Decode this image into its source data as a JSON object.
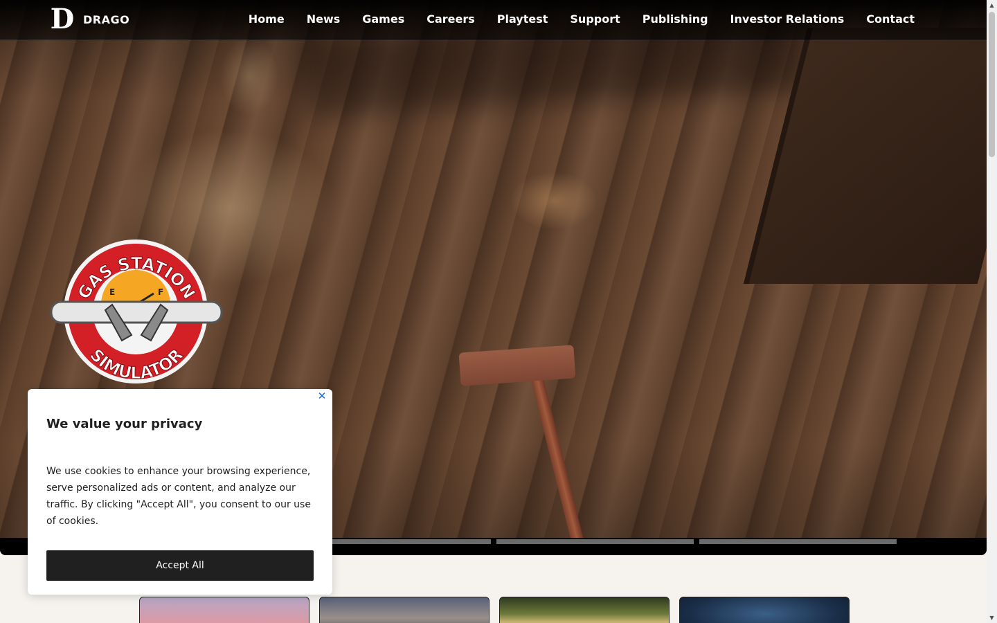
{
  "brand": {
    "logo_letter": "D",
    "name": "DRAGO"
  },
  "nav": {
    "items": [
      "Home",
      "News",
      "Games",
      "Careers",
      "Playtest",
      "Support",
      "Publishing",
      "Investor Relations",
      "Contact"
    ]
  },
  "hero": {
    "game_logo": {
      "top_text": "GAS STATION",
      "bottom_text": "SIMULATOR",
      "gauge_e": "E",
      "gauge_f": "F"
    },
    "slider_segments": 4
  },
  "cookie": {
    "title": "We value your privacy",
    "text": "We use cookies to enhance your browsing experience, serve personalized ads or content, and analyze our traffic. By clicking \"Accept All\", you consent to our use of cookies.",
    "accept_label": "Accept All",
    "close_icon": "close-icon"
  },
  "colors": {
    "accent": "#1863dc",
    "button": "#202020",
    "page_bg": "#f6f3ef"
  }
}
